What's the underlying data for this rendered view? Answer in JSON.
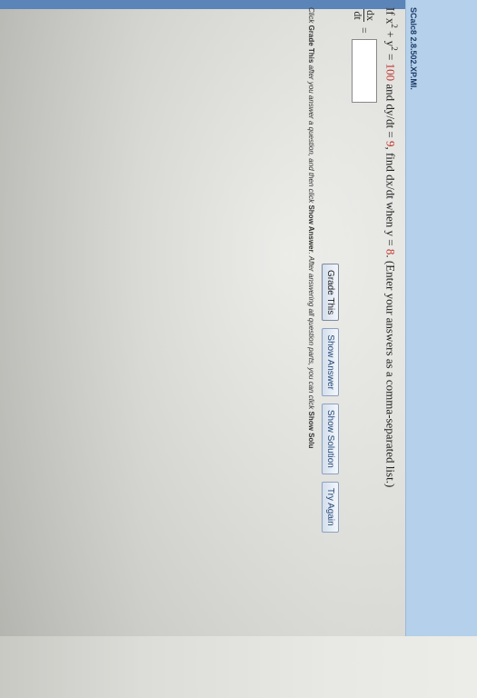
{
  "assignment": {
    "title": "SCalc8 2.8.502.XP.MI."
  },
  "question": {
    "prefix": "If x",
    "exp1": "2",
    "plus": " + y",
    "exp2": "2",
    "eq_part": " = ",
    "value1": "100",
    "mid": " and dy/dt = ",
    "value2": "9",
    "mid2": ", find dx/dt when y = ",
    "value3": "8",
    "suffix": ". (Enter your answers as a comma-separated list.)"
  },
  "answer": {
    "frac_num": "dx",
    "frac_den": "dt",
    "equals": "=",
    "value": ""
  },
  "buttons": {
    "grade": "Grade This",
    "show_answer": "Show Answer",
    "show_solution": "Show Solution",
    "try_again": "Try Again"
  },
  "hint": {
    "t1": "Click ",
    "b1": "Grade This",
    "t2": " after you answer a question, and then click ",
    "b2": "Show Answer",
    "t3": ". After answering all question parts, you can click ",
    "b3": "Show Solu"
  },
  "colors": {
    "header_bg": "#b4d0ea",
    "band": "#5b84b8",
    "value_red": "#c0342b"
  }
}
